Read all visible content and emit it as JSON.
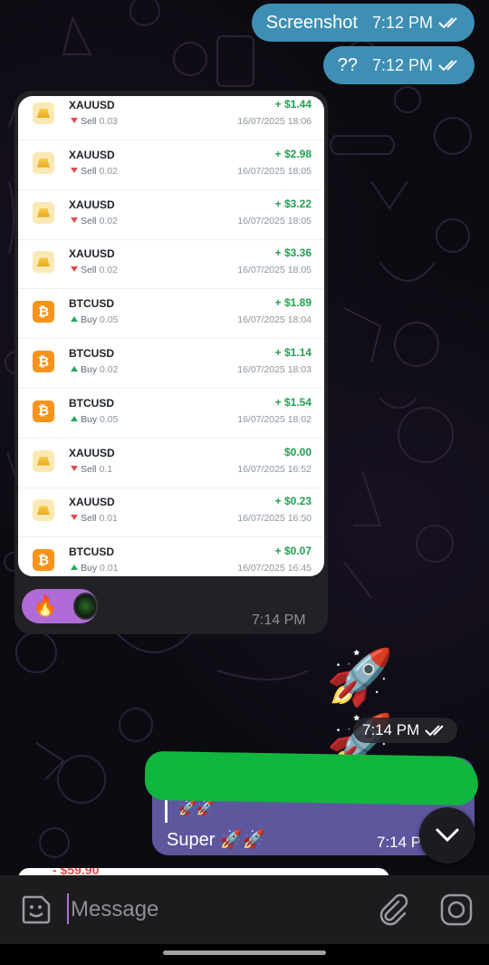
{
  "messages": {
    "screenshot": {
      "text": "Screenshot",
      "time": "7:12 PM"
    },
    "question": {
      "text": "??",
      "time": "7:12 PM"
    },
    "card_time": "7:14 PM",
    "reaction_emoji": "🔥",
    "rockets": "🚀🚀",
    "rockets_time": "7:14 PM",
    "reply": {
      "quote": "🚀🚀",
      "text": "Super 🚀🚀",
      "time": "7:14 P"
    },
    "peek_value": "- $59.90"
  },
  "trades": [
    {
      "symbol": "XAUUSD",
      "side": "Sell",
      "volume": "0.03",
      "pnl": "+ $1.44",
      "datetime": "16/07/2025 18:06",
      "asset": "gold"
    },
    {
      "symbol": "XAUUSD",
      "side": "Sell",
      "volume": "0.02",
      "pnl": "+ $2.98",
      "datetime": "16/07/2025 18:05",
      "asset": "gold"
    },
    {
      "symbol": "XAUUSD",
      "side": "Sell",
      "volume": "0.02",
      "pnl": "+ $3.22",
      "datetime": "16/07/2025 18:05",
      "asset": "gold"
    },
    {
      "symbol": "XAUUSD",
      "side": "Sell",
      "volume": "0.02",
      "pnl": "+ $3.36",
      "datetime": "16/07/2025 18:05",
      "asset": "gold"
    },
    {
      "symbol": "BTCUSD",
      "side": "Buy",
      "volume": "0.05",
      "pnl": "+ $1.89",
      "datetime": "16/07/2025 18:04",
      "asset": "btc"
    },
    {
      "symbol": "BTCUSD",
      "side": "Buy",
      "volume": "0.02",
      "pnl": "+ $1.14",
      "datetime": "16/07/2025 18:03",
      "asset": "btc"
    },
    {
      "symbol": "BTCUSD",
      "side": "Buy",
      "volume": "0.05",
      "pnl": "+ $1.54",
      "datetime": "16/07/2025 18:02",
      "asset": "btc"
    },
    {
      "symbol": "XAUUSD",
      "side": "Sell",
      "volume": "0.1",
      "pnl": "$0.00",
      "datetime": "16/07/2025 16:52",
      "asset": "gold"
    },
    {
      "symbol": "XAUUSD",
      "side": "Sell",
      "volume": "0.01",
      "pnl": "+ $0.23",
      "datetime": "16/07/2025 16:50",
      "asset": "gold"
    },
    {
      "symbol": "BTCUSD",
      "side": "Buy",
      "volume": "0.01",
      "pnl": "+ $0.07",
      "datetime": "16/07/2025 16:45",
      "asset": "btc"
    }
  ],
  "input": {
    "placeholder": "Message"
  },
  "icons": {
    "btc": "₿",
    "emoji": "sticker-emoji-icon",
    "attach": "paperclip-icon",
    "camera": "camera-icon",
    "scroll": "chevron-down-icon"
  },
  "colors": {
    "outgoing": "#3f8fb4",
    "reply_bubble": "#5d579e",
    "profit": "#21a050",
    "sell": "#e54a4a",
    "buy": "#26a65b",
    "reaction": "#b06bd6"
  }
}
